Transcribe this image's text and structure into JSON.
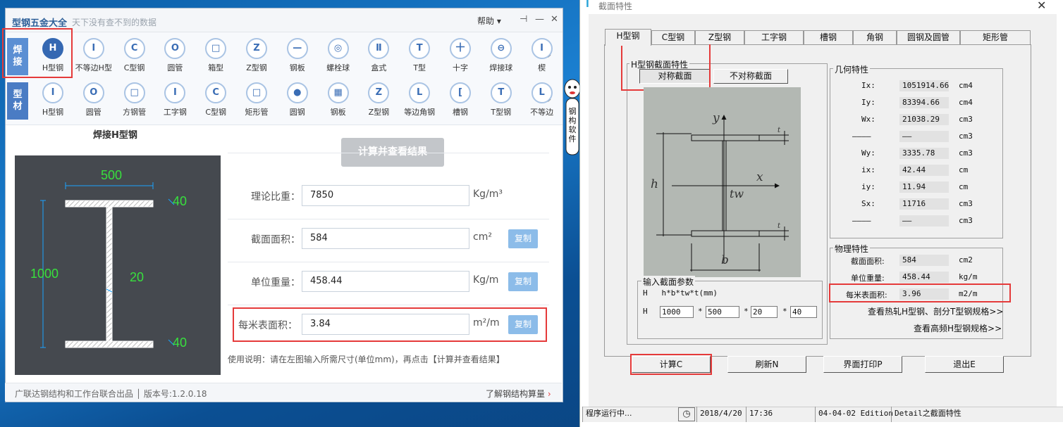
{
  "left_app": {
    "title": "型钢五金大全",
    "slogan": "天下没有查不到的数据",
    "help_label": "帮助",
    "sidebar_tabs": [
      {
        "label": "焊\n接",
        "color": "#5b8fd3"
      },
      {
        "label": "型\n材",
        "color": "#4a7cc4"
      }
    ],
    "welded_items": [
      {
        "label": "H型钢",
        "icon": "H"
      },
      {
        "label": "不等边H型",
        "icon": "I"
      },
      {
        "label": "C型钢",
        "icon": "C"
      },
      {
        "label": "圆管",
        "icon": "O"
      },
      {
        "label": "箱型",
        "icon": "□"
      },
      {
        "label": "Z型钢",
        "icon": "Z"
      },
      {
        "label": "钢板",
        "icon": "—"
      },
      {
        "label": "螺栓球",
        "icon": "◎"
      },
      {
        "label": "盒式",
        "icon": "Ⅱ"
      },
      {
        "label": "T型",
        "icon": "T"
      },
      {
        "label": "十字",
        "icon": "十"
      },
      {
        "label": "焊接球",
        "icon": "⊖"
      },
      {
        "label": "楔",
        "icon": "I"
      }
    ],
    "profile_items": [
      {
        "label": "H型钢",
        "icon": "I"
      },
      {
        "label": "圆管",
        "icon": "O"
      },
      {
        "label": "方钢管",
        "icon": "□"
      },
      {
        "label": "工字钢",
        "icon": "I"
      },
      {
        "label": "C型钢",
        "icon": "C"
      },
      {
        "label": "矩形管",
        "icon": "□"
      },
      {
        "label": "圆钢",
        "icon": "●"
      },
      {
        "label": "钢板",
        "icon": "▦"
      },
      {
        "label": "Z型钢",
        "icon": "Z"
      },
      {
        "label": "等边角钢",
        "icon": "L"
      },
      {
        "label": "槽钢",
        "icon": "["
      },
      {
        "label": "T型钢",
        "icon": "T"
      },
      {
        "label": "不等边",
        "icon": "L"
      }
    ],
    "diagram_title": "焊接H型钢",
    "dims": {
      "b": "500",
      "t_top": "40",
      "h": "1000",
      "tw": "20",
      "t_bottom": "40"
    },
    "calc_button": "计算并查看结果",
    "fields": [
      {
        "label": "理论比重：",
        "value": "7850",
        "unit": "Kg/m³",
        "copy": ""
      },
      {
        "label": "截面面积：",
        "value": "584",
        "unit": "cm²",
        "copy": "复制"
      },
      {
        "label": "单位重量：",
        "value": "458.44",
        "unit": "Kg/m",
        "copy": "复制"
      },
      {
        "label": "每米表面积：",
        "value": "3.84",
        "unit": "m²/m",
        "copy": "复制"
      }
    ],
    "usage": "使用说明：请在左图输入所需尺寸(单位mm)，再点击【计算并查看结果】",
    "footer": "广联达钢结构和工作台联合出品 │ 版本号:1.2.0.18",
    "footer_link": "了解钢结构算量"
  },
  "mascot_text": "钢构软件",
  "right_app": {
    "title": "截面特性",
    "tabs": [
      "H型钢",
      "C型钢",
      "Z型钢",
      "工字钢",
      "槽钢",
      "角钢",
      "圆钢及圆管",
      "矩形管"
    ],
    "section_group": "H型钢截面特性",
    "sym_btn": "对称截面",
    "asym_btn": "不对称截面",
    "drawing_labels": {
      "y": "y",
      "x": "x",
      "h": "h",
      "tw": "tw",
      "b": "b",
      "t1": "t",
      "t2": "t"
    },
    "geom_group": "几何特性",
    "geom": [
      {
        "label": "Ix:",
        "value": "1051914.66",
        "unit": "cm4"
      },
      {
        "label": "Iy:",
        "value": "83394.66",
        "unit": "cm4"
      },
      {
        "label": "Wx:",
        "value": "21038.29",
        "unit": "cm3"
      },
      {
        "label": "————",
        "value": "——",
        "unit": "cm3"
      },
      {
        "label": "Wy:",
        "value": "3335.78",
        "unit": "cm3"
      },
      {
        "label": "ix:",
        "value": "42.44",
        "unit": "cm"
      },
      {
        "label": "iy:",
        "value": "11.94",
        "unit": "cm"
      },
      {
        "label": "Sx:",
        "value": "11716",
        "unit": "cm3"
      },
      {
        "label": "————",
        "value": "——",
        "unit": "cm3"
      }
    ],
    "phys_group": "物理特性",
    "phys": [
      {
        "label": "截面面积:",
        "value": "584",
        "unit": "cm2"
      },
      {
        "label": "单位重量:",
        "value": "458.44",
        "unit": "kg/m"
      },
      {
        "label": "每米表面积:",
        "value": "3.96",
        "unit": "m2/m"
      }
    ],
    "link1": "查看热轧H型钢、剖分T型钢规格>>",
    "link2": "查看高频H型钢规格>>",
    "input_group": "输入截面参数",
    "input_formula": "H   h*b*tw*t(mm)",
    "input_prefix": "H",
    "inputs": [
      "1000",
      "500",
      "20",
      "40"
    ],
    "star": "*",
    "buttons": [
      "计算C",
      "刷新N",
      "界面打印P",
      "退出E"
    ],
    "status": [
      "程序运行中...",
      "2018/4/20",
      "17:36",
      "04-04-02 Edition",
      "Detail之截面特性"
    ]
  }
}
